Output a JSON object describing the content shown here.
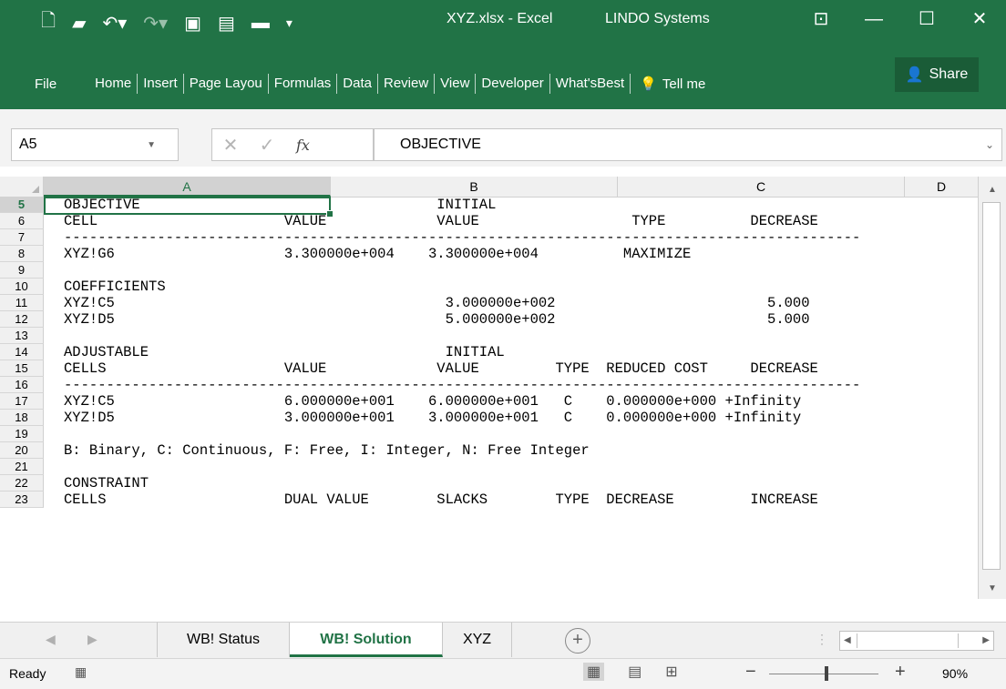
{
  "titlebar": {
    "title": "XYZ.xlsx - Excel",
    "addin": "LINDO Systems",
    "qat_icons": [
      "new-file-icon",
      "open-folder-icon",
      "undo-icon",
      "redo-icon",
      "save-icon",
      "save-as-icon",
      "open-icon",
      "customize-icon"
    ],
    "window_buttons": [
      "ribbon-display-icon",
      "minimize-icon",
      "maximize-icon",
      "close-icon"
    ]
  },
  "ribbon": {
    "file": "File",
    "tabs": [
      "Home",
      "Insert",
      "Page Layou",
      "Formulas",
      "Data",
      "Review",
      "View",
      "Developer",
      "What'sBest"
    ],
    "tell_me": "Tell me",
    "share": "Share"
  },
  "formula_bar": {
    "name_box": "A5",
    "fx": "fx",
    "formula": "OBJECTIVE"
  },
  "columns": [
    "A",
    "B",
    "C",
    "D"
  ],
  "rows": [
    {
      "num": "5",
      "text": "OBJECTIVE                                   INITIAL"
    },
    {
      "num": "6",
      "text": "CELL                      VALUE             VALUE                  TYPE          DECREASE"
    },
    {
      "num": "7",
      "text": "----------------------------------------------------------------------------------------------"
    },
    {
      "num": "8",
      "text": "XYZ!G6                    3.300000e+004    3.300000e+004          MAXIMIZE"
    },
    {
      "num": "9",
      "text": ""
    },
    {
      "num": "10",
      "text": "COEFFICIENTS"
    },
    {
      "num": "11",
      "text": "XYZ!C5                                       3.000000e+002                         5.000"
    },
    {
      "num": "12",
      "text": "XYZ!D5                                       5.000000e+002                         5.000"
    },
    {
      "num": "13",
      "text": ""
    },
    {
      "num": "14",
      "text": "ADJUSTABLE                                   INITIAL"
    },
    {
      "num": "15",
      "text": "CELLS                     VALUE             VALUE         TYPE  REDUCED COST     DECREASE"
    },
    {
      "num": "16",
      "text": "----------------------------------------------------------------------------------------------"
    },
    {
      "num": "17",
      "text": "XYZ!C5                    6.000000e+001    6.000000e+001   C    0.000000e+000 +Infinity"
    },
    {
      "num": "18",
      "text": "XYZ!D5                    3.000000e+001    3.000000e+001   C    0.000000e+000 +Infinity"
    },
    {
      "num": "19",
      "text": ""
    },
    {
      "num": "20",
      "text": "B: Binary, C: Continuous, F: Free, I: Integer, N: Free Integer"
    },
    {
      "num": "21",
      "text": ""
    },
    {
      "num": "22",
      "text": "CONSTRAINT"
    },
    {
      "num": "23",
      "text": "CELLS                     DUAL VALUE        SLACKS        TYPE  DECREASE         INCREASE"
    }
  ],
  "sheet_tabs": [
    "WB! Status",
    "WB! Solution",
    "XYZ"
  ],
  "active_sheet": "WB! Solution",
  "status": {
    "ready": "Ready",
    "zoom": "90%"
  }
}
